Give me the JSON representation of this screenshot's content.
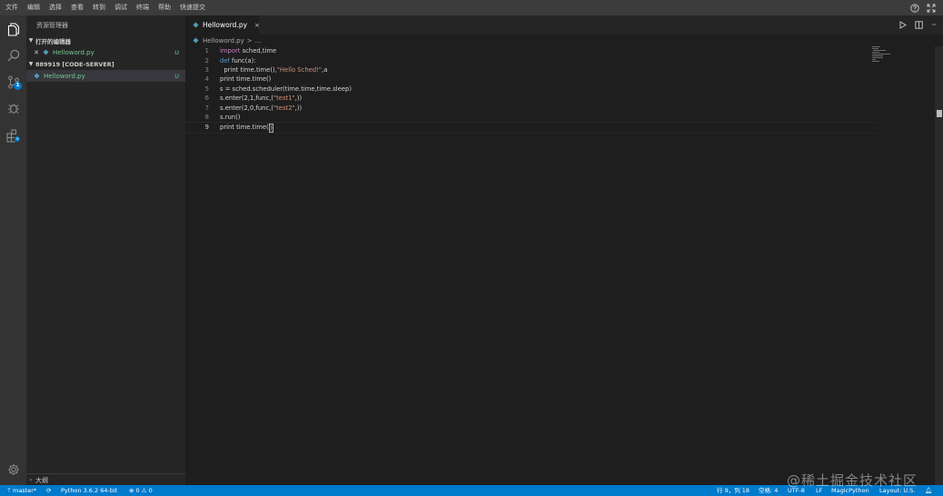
{
  "menu": [
    "文件",
    "编辑",
    "选择",
    "查看",
    "转到",
    "调试",
    "终端",
    "帮助",
    "快速提交"
  ],
  "sidebar": {
    "title": "资源管理器",
    "open_editors_label": "打开的编辑器",
    "open_file": {
      "name": "Helloword.py",
      "status": "U"
    },
    "workspace_label": "889919 [CODE-SERVER]",
    "workspace_file": {
      "name": "Helloword.py",
      "status": "U"
    },
    "outline_label": "大纲"
  },
  "scm_badge": "1",
  "tab": {
    "label": "Helloword.py",
    "close": "×"
  },
  "breadcrumb": {
    "file": "Helloword.py",
    "sep": ">",
    "more": "..."
  },
  "code_lines": [
    {
      "n": "1",
      "parts": [
        {
          "t": "import",
          "c": "kw"
        },
        {
          "t": " sched,time",
          "c": ""
        }
      ]
    },
    {
      "n": "2",
      "parts": [
        {
          "t": "def",
          "c": "def"
        },
        {
          "t": " func(a):",
          "c": ""
        }
      ]
    },
    {
      "n": "3",
      "parts": [
        {
          "t": "  print time.time(),",
          "c": ""
        },
        {
          "t": "\"Hello Sched!\"",
          "c": "str"
        },
        {
          "t": ",a",
          "c": ""
        }
      ]
    },
    {
      "n": "4",
      "parts": [
        {
          "t": "print time.time()",
          "c": ""
        }
      ]
    },
    {
      "n": "5",
      "parts": [
        {
          "t": "s = sched.scheduler(time.time,time.sleep)",
          "c": ""
        }
      ]
    },
    {
      "n": "6",
      "parts": [
        {
          "t": "s.enter(2,1,func,(",
          "c": ""
        },
        {
          "t": "\"test1\"",
          "c": "str"
        },
        {
          "t": ",))",
          "c": ""
        }
      ]
    },
    {
      "n": "7",
      "parts": [
        {
          "t": "s.enter(2,0,func,(",
          "c": ""
        },
        {
          "t": "\"test2\"",
          "c": "str"
        },
        {
          "t": ",))",
          "c": ""
        }
      ]
    },
    {
      "n": "8",
      "parts": [
        {
          "t": "s.run()",
          "c": ""
        }
      ]
    },
    {
      "n": "9",
      "parts": [
        {
          "t": "print time.time(",
          "c": ""
        }
      ]
    }
  ],
  "cursor_line": "9",
  "cursor_char": ")",
  "statusbar": {
    "branch": "master*",
    "python": "Python 3.6.2 64-bit",
    "errors": "0",
    "warnings": "0",
    "position": "行 9，列 18",
    "spaces": "空格: 4",
    "encoding": "UTF-8",
    "eol": "LF",
    "language": "MagicPython",
    "layout": "Layout: U.S."
  },
  "watermark": "@稀土掘金技术社区",
  "colors": {
    "accent": "#007acc",
    "untracked": "#73c991",
    "keyword": "#c586c0",
    "string": "#ce9178"
  }
}
